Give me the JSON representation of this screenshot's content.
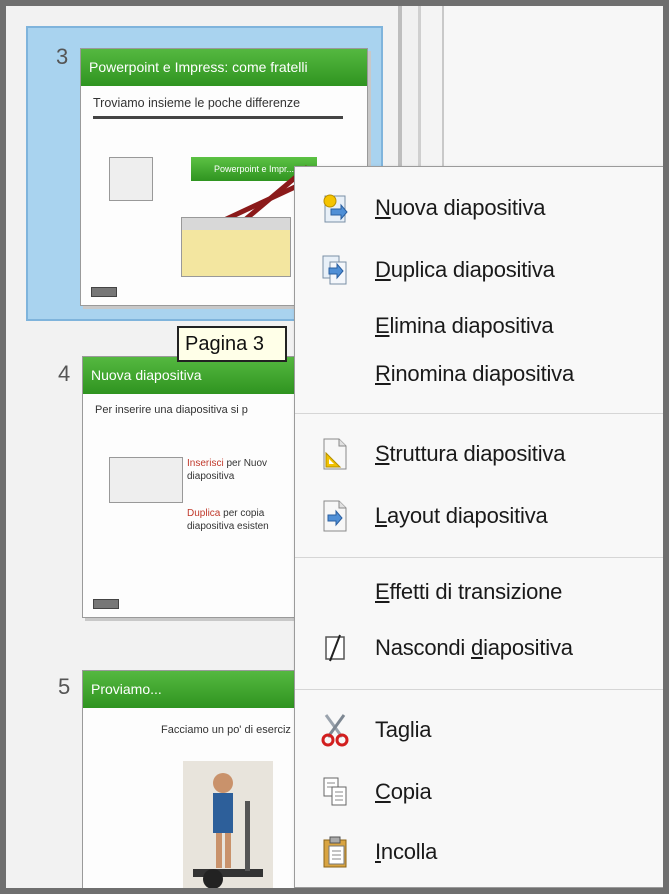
{
  "slides": [
    {
      "number": "3",
      "title": "Powerpoint e Impress: come fratelli",
      "subtitle": "Troviamo insieme le poche differenze",
      "inner_label": "Powerpoint e Impr..."
    },
    {
      "number": "4",
      "title": "Nuova diapositiva",
      "subtitle": "Per inserire una diapositiva si p",
      "red1": "Inserisci",
      "text1a": " per Nuov",
      "text1b": "diapositiva",
      "red2": "Duplica",
      "text2a": " per copia",
      "text2b": "diapositiva esisten"
    },
    {
      "number": "5",
      "title": "Proviamo...",
      "subtitle": "Facciamo un po' di eserciz"
    }
  ],
  "tooltip": "Pagina 3",
  "context_menu": {
    "items": [
      {
        "pre": "",
        "key": "N",
        "post": "uova diapositiva",
        "icon": "new-slide-icon"
      },
      {
        "pre": "",
        "key": "D",
        "post": "uplica diapositiva",
        "icon": "duplicate-slide-icon"
      },
      {
        "pre": "",
        "key": "E",
        "post": "limina diapositiva",
        "icon": ""
      },
      {
        "pre": "",
        "key": "R",
        "post": "inomina diapositiva",
        "icon": ""
      },
      {
        "pre": "",
        "key": "S",
        "post": "truttura diapositiva",
        "icon": "slide-design-icon"
      },
      {
        "pre": "",
        "key": "L",
        "post": "ayout diapositiva",
        "icon": "slide-layout-icon"
      },
      {
        "pre": "",
        "key": "E",
        "post": "ffetti di transizione",
        "icon": ""
      },
      {
        "pre": "Nascondi ",
        "key": "d",
        "post": "iapositiva",
        "icon": "hide-slide-icon"
      },
      {
        "pre": "Ta",
        "key": "g",
        "post": "lia",
        "icon": "scissors-icon"
      },
      {
        "pre": "",
        "key": "C",
        "post": "opia",
        "icon": "copy-icon"
      },
      {
        "pre": "",
        "key": "I",
        "post": "ncolla",
        "icon": "paste-icon"
      }
    ]
  },
  "colors": {
    "selection": "#a9d3ef",
    "title_bar": "#3aa52a",
    "menu_bg": "#f8f8f8"
  }
}
